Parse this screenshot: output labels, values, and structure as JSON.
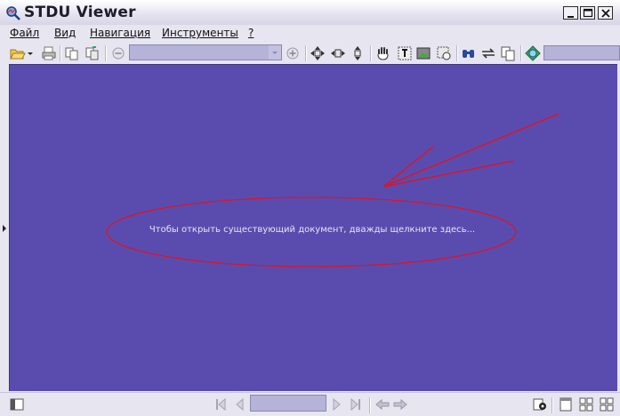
{
  "window": {
    "title": "STDU Viewer",
    "icon": "stdu-logo-icon",
    "controls": [
      "minimize",
      "maximize",
      "close"
    ]
  },
  "menu": {
    "items": [
      {
        "label": "Файл"
      },
      {
        "label": "Вид"
      },
      {
        "label": "Навигация"
      },
      {
        "label": "Инструменты"
      },
      {
        "label": "?"
      }
    ]
  },
  "toolbar": {
    "zoom_value": "",
    "search_value": "",
    "buttons": [
      "open-icon",
      "open-dropdown-icon",
      "print-icon",
      "copy-icon",
      "copy-page-icon",
      "zoom-out-icon",
      "zoom-in-icon",
      "fit-page-icon",
      "fit-width-icon",
      "fit-height-icon",
      "hand-tool-icon",
      "text-select-icon",
      "image-select-icon",
      "snapshot-icon",
      "find-icon",
      "rotate-icon",
      "two-pages-icon",
      "globe-icon"
    ]
  },
  "document": {
    "hint": "Чтобы открыть существующий документ, дважды щелкните здесь...",
    "background": "#5a4cae",
    "annotation_color": "#d8162a"
  },
  "statusbar": {
    "page_value": "",
    "buttons": [
      "sidebar-toggle-icon",
      "first-page-icon",
      "prev-page-icon",
      "next-page-icon",
      "last-page-icon",
      "back-icon",
      "forward-icon",
      "settings-icon",
      "single-page-view-icon",
      "continuous-view-icon",
      "facing-view-icon"
    ]
  }
}
